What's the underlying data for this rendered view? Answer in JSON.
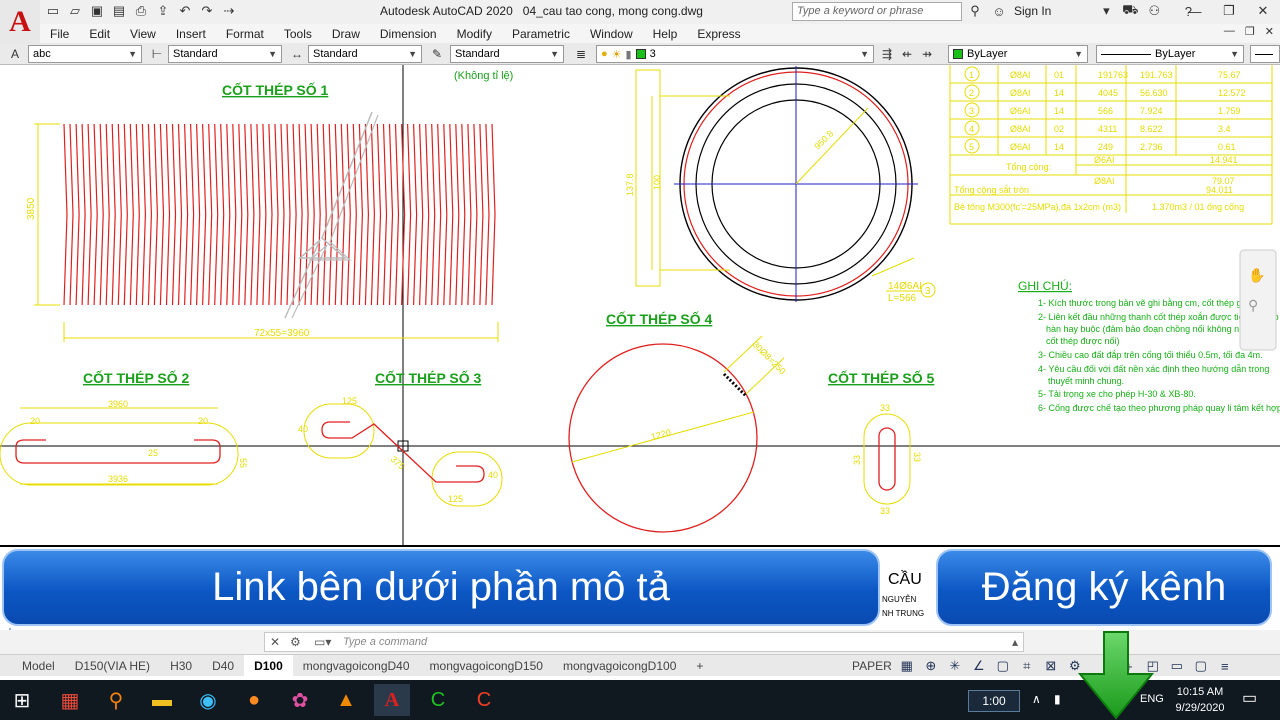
{
  "window": {
    "app_name": "Autodesk AutoCAD 2020",
    "file_name": "04_cau tao cong, mong cong.dwg",
    "search_placeholder": "Type a keyword or phrase",
    "sign_in": "Sign In"
  },
  "menu": [
    "File",
    "Edit",
    "View",
    "Insert",
    "Format",
    "Tools",
    "Draw",
    "Dimension",
    "Modify",
    "Parametric",
    "Window",
    "Help",
    "Express"
  ],
  "toolbar": {
    "text_style_sample": "abc",
    "text_style": "Standard",
    "dim_style": "Standard",
    "table_style": "Standard",
    "layer_current": "3",
    "color": "ByLayer",
    "linetype": "ByLayer"
  },
  "drawing": {
    "scale_note": "(Không tỉ lệ)",
    "labels": {
      "rebar1": "CỐT THÉP SỐ 1",
      "rebar2": "CỐT THÉP SỐ 2",
      "rebar3": "CỐT THÉP SỐ 3",
      "rebar4": "CỐT THÉP SỐ 4",
      "rebar5": "CỐT THÉP SỐ 5"
    },
    "dims": {
      "r1_height": "3850",
      "r1_length": "72x55=3960",
      "r2_top": "3960",
      "r2_bottom": "3936",
      "r2_left": "20",
      "r2_right": "20",
      "r2_mid": "25",
      "r2_end": "55",
      "r3_top": "125",
      "r3_bottom": "125",
      "r3_left": "40",
      "r3_right": "40",
      "r3_diag": "375",
      "r4_dia": "1220",
      "r4_lap": "30Ø8=250",
      "r5_top": "33",
      "r5_bottom": "33",
      "r5_side": "33",
      "r5_side2": "33",
      "circ_h1": "137.8",
      "circ_h2": "100",
      "circ_r": "950.8",
      "mark_count": "14Ø6AI",
      "mark_len": "L=566",
      "mark_no": "3"
    },
    "table": {
      "rows": [
        {
          "no": "1",
          "dia": "Ø8AI",
          "qty": "01",
          "len": "191763",
          "total": "191.763",
          "weight": "75.67"
        },
        {
          "no": "2",
          "dia": "Ø8AI",
          "qty": "14",
          "len": "4045",
          "total": "56.630",
          "weight": "12.572"
        },
        {
          "no": "3",
          "dia": "Ø6AI",
          "qty": "14",
          "len": "566",
          "total": "7.924",
          "weight": "1.759"
        },
        {
          "no": "4",
          "dia": "Ø8AI",
          "qty": "02",
          "len": "4311",
          "total": "8.622",
          "weight": "3.4"
        },
        {
          "no": "5",
          "dia": "Ø6AI",
          "qty": "14",
          "len": "249",
          "total": "2.736",
          "weight": "0.61"
        }
      ],
      "total_label": "Tổng cộng:",
      "total_d6": "Ø6AI",
      "total_d6_value": "14.941",
      "total_d8": "Ø8AI",
      "total_d8_value": "79.07",
      "steel_label": "Tổng cộng sắt tròn",
      "steel_value": "94.011",
      "concrete_label": "Bê tông M300(fc'=25MPa),đá 1x2cm (m3)",
      "concrete_value": "1.370m3 / 01 ống cống"
    },
    "notes": {
      "title": "GHI CHÚ:",
      "items": [
        "1- Kích thước trong bản vẽ ghi bằng cm, cốt thép ghi bằng",
        "2- Liên kết đầu những thanh cốt thép xoắn được tiến hành b",
        "hàn hay buộc (đảm bảo đoạn chồng nối không nhỏ hơn 3",
        "cốt thép được nối)",
        "3- Chiều cao đất đắp trên cống tối thiểu 0.5m, tối đa 4m.",
        "4- Yêu cầu đối với đất nền xác định theo hướng dẫn trong",
        "thuyết minh chung.",
        "5- Tải trọng xe cho phép H-30 & XB-80.",
        "6- Cống được chế tạo theo phương pháp quay li tâm kết hợp"
      ]
    },
    "title_block_peek": "CẦU",
    "title_block_sub1": "NGUYỄN",
    "title_block_sub2": "NH TRUNG"
  },
  "banners": {
    "left": "Link bên dưới phần mô tả",
    "right": "Đăng ký kênh"
  },
  "command": {
    "placeholder": "Type a command"
  },
  "layout_tabs": [
    "Model",
    "D150(VIA HE)",
    "H30",
    "D40",
    "D100",
    "mongvagoicongD40",
    "mongvagoicongD150",
    "mongvagoicongD100"
  ],
  "active_tab": "D100",
  "status": {
    "paper": "PAPER",
    "scale": "1:00"
  },
  "taskbar": {
    "lang": "ENG",
    "time": "10:15 AM",
    "date": "9/29/2020"
  },
  "colors": {
    "rebar_red": "#e02020",
    "dim_yellow": "#e6dc00",
    "label_green": "#1aa01a",
    "notes_green": "#18b018",
    "banner_blue": "#0c57c4"
  }
}
